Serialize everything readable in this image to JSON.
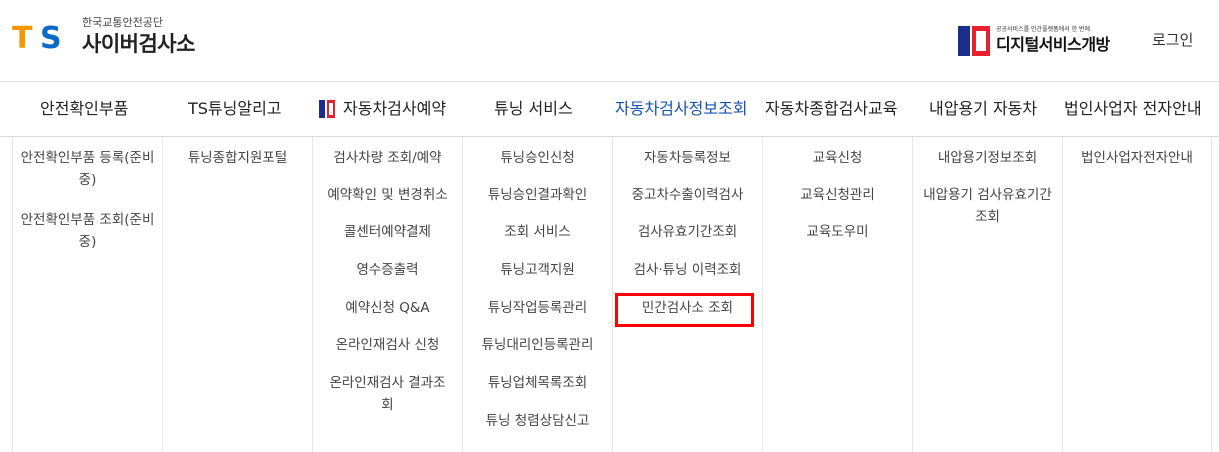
{
  "header": {
    "org_name": "한국교통안전공단",
    "site_name": "사이버검사소",
    "logo_letters": {
      "t": "T",
      "s": "S"
    },
    "partner_sub": "공공서비스를 민간플랫폼에서 한 번에",
    "partner_name": "디지털서비스개방",
    "login_label": "로그인"
  },
  "gnb": [
    {
      "label": "안전확인부품"
    },
    {
      "label": "TS튜닝알리고"
    },
    {
      "label": "자동차검사예약",
      "icon": "digital-service-icon"
    },
    {
      "label": "튜닝 서비스"
    },
    {
      "label": "자동차검사정보조회",
      "active": true
    },
    {
      "label": "자동차종합검사교육"
    },
    {
      "label": "내압용기 자동차"
    },
    {
      "label": "법인사업자 전자안내"
    }
  ],
  "submenu": [
    [
      "안전확인부품 등록(준비중)",
      "안전확인부품 조회(준비중)"
    ],
    [
      "튜닝종합지원포털"
    ],
    [
      "검사차량 조회/예약",
      "예약확인 및 변경취소",
      "콜센터예약결제",
      "영수증출력",
      "예약신청 Q&A",
      "온라인재검사 신청",
      "온라인재검사 결과조회"
    ],
    [
      "튜닝승인신청",
      "튜닝승인결과확인",
      "조회 서비스",
      "튜닝고객지원",
      "튜닝작업등록관리",
      "튜닝대리인등록관리",
      "튜닝업체목록조회",
      "튜닝 청렴상담신고"
    ],
    [
      "자동차등록정보",
      "중고차수출이력검사",
      "검사유효기간조회",
      "검사·튜닝 이력조회",
      "민간검사소 조회"
    ],
    [
      "교육신청",
      "교육신청관리",
      "교육도우미"
    ],
    [
      "내압용기정보조회",
      "내압용기 검사유효기간 조회"
    ],
    [
      "법인사업자전자안내"
    ]
  ],
  "highlight_target": "민간검사소 조회",
  "colors": {
    "accent": "#1553b5",
    "ts_orange": "#f39800",
    "ts_blue": "#0a6bc7",
    "highlight": "#ff0000"
  }
}
